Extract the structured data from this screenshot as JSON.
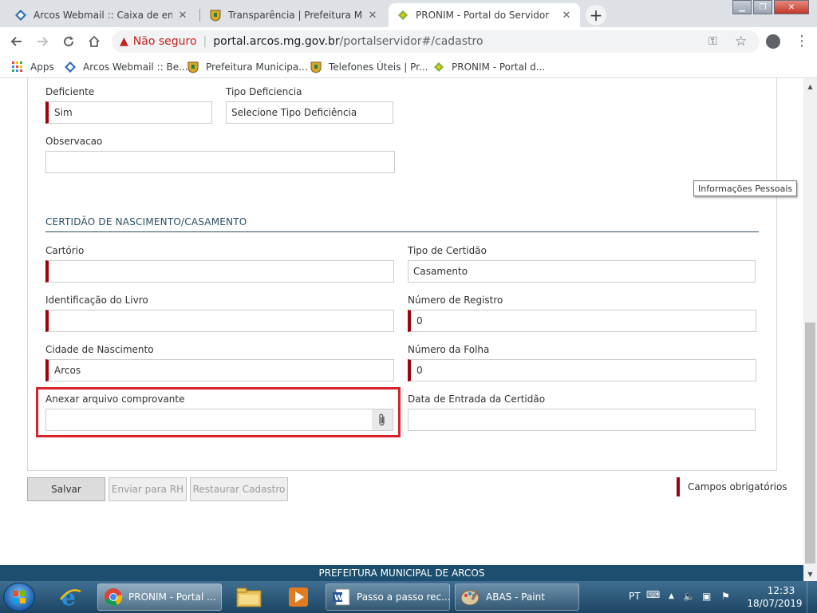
{
  "browser": {
    "tabs": [
      {
        "title": "Arcos Webmail :: Caixa de entrad",
        "close": "✕",
        "icon": "webmail-diamond-icon"
      },
      {
        "title": "Transparência | Prefeitura Munic",
        "close": "✕",
        "icon": "city-crest-icon"
      },
      {
        "title": "PRONIM - Portal do Servidor",
        "close": "✕",
        "icon": "pronim-icon",
        "active": true
      }
    ],
    "new_tab": "+",
    "address": {
      "security_label": "Não seguro",
      "separator": "|",
      "url_host": "portal.arcos.mg.gov.br",
      "url_path": "/portalservidor#/cadastro"
    },
    "bookmarks": [
      {
        "label": "Apps",
        "icon": "apps-grid-icon"
      },
      {
        "label": "Arcos Webmail :: Be...",
        "icon": "webmail-diamond-icon"
      },
      {
        "label": "Prefeitura Municipa...",
        "icon": "city-crest-icon"
      },
      {
        "label": "Telefones Úteis | Pr...",
        "icon": "city-crest-icon"
      },
      {
        "label": "PRONIM - Portal d...",
        "icon": "pronim-icon"
      }
    ]
  },
  "form": {
    "deficiente": {
      "label": "Deficiente",
      "value": "Sim"
    },
    "tipo_deficiencia": {
      "label": "Tipo Deficiencia",
      "value": "Selecione Tipo Deficiência"
    },
    "observacao": {
      "label": "Observacao",
      "value": ""
    },
    "tooltip": "Informações Pessoais",
    "section_title": "CERTIDÃO DE NASCIMENTO/CASAMENTO",
    "cartorio": {
      "label": "Cartório",
      "value": ""
    },
    "tipo_certidao": {
      "label": "Tipo de Certidão",
      "value": "Casamento"
    },
    "identificacao_livro": {
      "label": "Identificação do Livro",
      "value": ""
    },
    "numero_registro": {
      "label": "Número de Registro",
      "value": "0"
    },
    "cidade_nascimento": {
      "label": "Cidade de Nascimento",
      "value": "Arcos"
    },
    "numero_folha": {
      "label": "Número da Folha",
      "value": "0"
    },
    "anexar_arquivo": {
      "label": "Anexar arquivo comprovante",
      "value": ""
    },
    "data_entrada": {
      "label": "Data de Entrada da Certidão",
      "value": ""
    }
  },
  "actions": {
    "save": "Salvar",
    "send_rh": "Enviar para RH",
    "restore": "Restaurar Cadastro",
    "required_legend": "Campos obrigatórios"
  },
  "footer": {
    "text": "PREFEITURA MUNICIPAL DE ARCOS"
  },
  "taskbar": {
    "tasks": [
      {
        "label": "PRONIM - Portal ...",
        "icon": "chrome-icon",
        "active": true
      },
      {
        "label": "Passo a passo rec...",
        "icon": "word-icon"
      },
      {
        "label": "ABAS - Paint",
        "icon": "paint-icon"
      }
    ],
    "tray": {
      "language": "PT",
      "time": "12:33",
      "date": "18/07/2019"
    }
  },
  "colors": {
    "required_marker": "#a00010",
    "section_blue": "#2b4f66",
    "footer_blue": "#1c4f6f",
    "highlight_red": "#d9212c"
  }
}
